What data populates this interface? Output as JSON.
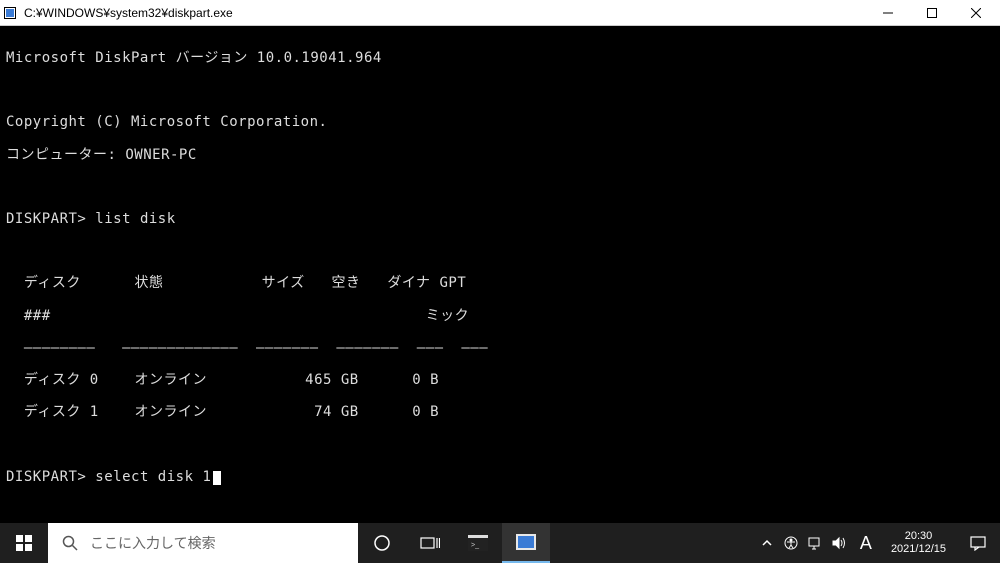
{
  "window": {
    "title": "C:¥WINDOWS¥system32¥diskpart.exe",
    "controls": {
      "min": "—",
      "max": "▢",
      "close": "✕"
    }
  },
  "console": {
    "header1": "Microsoft DiskPart バージョン 10.0.19041.964",
    "copyright": "Copyright (C) Microsoft Corporation.",
    "computer": "コンピューター: OWNER-PC",
    "prompt1": "DISKPART> ",
    "cmd1": "list disk",
    "tbl_hdr_l1": "  ディスク      状態           サイズ   空き   ダイナ GPT",
    "tbl_hdr_l2": "  ###                                          ミック",
    "tbl_sep": "  ––––––––   –––––––––––––  –––––––  –––––––  –––  –––",
    "tbl_row0": "  ディスク 0    オンライン           465 GB      0 B",
    "tbl_row1": "  ディスク 1    オンライン            74 GB      0 B",
    "prompt2": "DISKPART> ",
    "cmd2": "select disk 1"
  },
  "chart_data": {
    "type": "table",
    "title": "list disk",
    "columns": [
      "ディスク ###",
      "状態",
      "サイズ",
      "空き",
      "ダイナミック",
      "GPT"
    ],
    "rows": [
      [
        "ディスク 0",
        "オンライン",
        "465 GB",
        "0 B",
        "",
        ""
      ],
      [
        "ディスク 1",
        "オンライン",
        "74 GB",
        "0 B",
        "",
        ""
      ]
    ]
  },
  "taskbar": {
    "search_placeholder": "ここに入力して検索",
    "ime": "A",
    "time": "20:30",
    "date": "2021/12/15"
  }
}
